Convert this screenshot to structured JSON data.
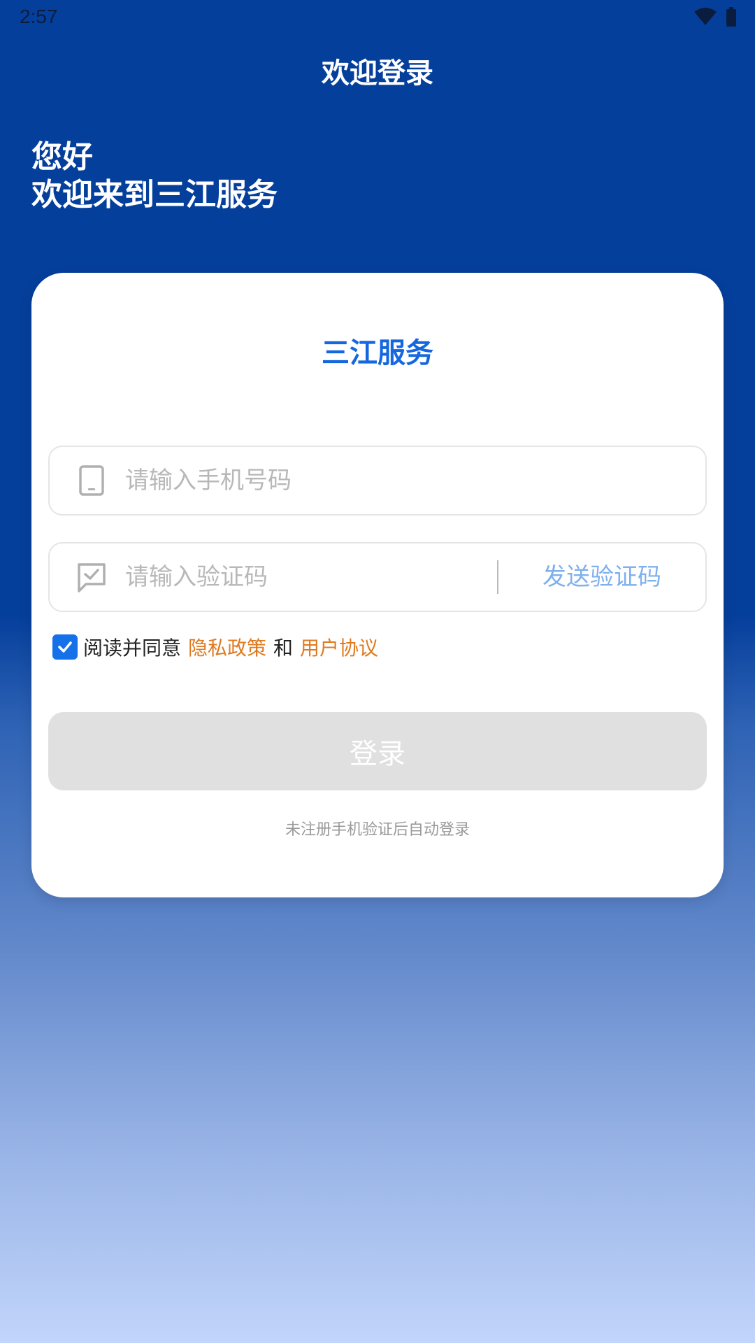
{
  "status_bar": {
    "time": "2:57",
    "icons": [
      "wifi-icon",
      "battery-icon"
    ]
  },
  "header": {
    "title": "欢迎登录"
  },
  "greeting": {
    "line1": "您好",
    "line2": "欢迎来到三江服务"
  },
  "card": {
    "title": "三江服务",
    "phone_field": {
      "icon": "phone-icon",
      "placeholder": "请输入手机号码",
      "value": ""
    },
    "code_field": {
      "icon": "message-check-icon",
      "placeholder": "请输入验证码",
      "value": "",
      "send_label": "发送验证码"
    },
    "agreement": {
      "checked": true,
      "prefix": "阅读并同意",
      "privacy_label": "隐私政策",
      "conjunction": "和",
      "terms_label": "用户协议"
    },
    "login_label": "登录",
    "hint": "未注册手机验证后自动登录"
  },
  "colors": {
    "header_bg": "#053f9c",
    "accent": "#1467e0",
    "link": "#e07a1f",
    "send_code": "#7fb0ee",
    "login_disabled": "#e0e0e0"
  }
}
